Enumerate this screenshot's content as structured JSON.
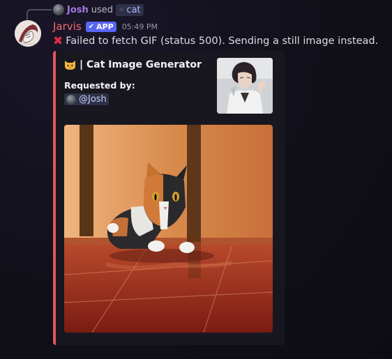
{
  "reply": {
    "username": "Josh",
    "used_text": "used",
    "command": "cat",
    "command_icon": "slash-command-icon"
  },
  "message": {
    "author": "Jarvis",
    "badge": "APP",
    "timestamp": "05:49 PM",
    "text": "Failed to fetch GIF (status 500). Sending a still image instead.",
    "status_icon": "cross-mark-icon",
    "author_color": "#f06a72"
  },
  "embed": {
    "title": "| Cat Image Generator",
    "title_icon": "cat-face-emoji-icon",
    "field_name": "Requested by:",
    "field_value": "@Josh",
    "accent_color": "#e0575d"
  }
}
